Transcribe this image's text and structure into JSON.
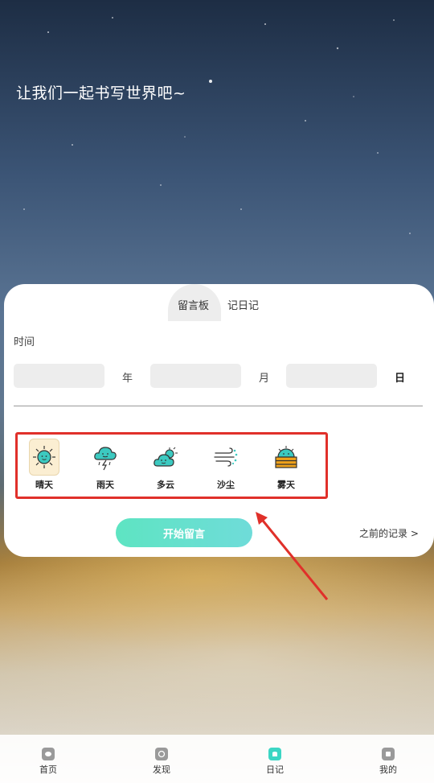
{
  "slogan": "让我们一起书写世界吧~",
  "tabs": [
    {
      "label": "留言板",
      "active": true
    },
    {
      "label": "记日记",
      "active": false
    }
  ],
  "form": {
    "time_label": "时间",
    "year_unit": "年",
    "month_unit": "月",
    "day_unit": "日",
    "year_value": "",
    "month_value": "",
    "day_value": ""
  },
  "weather": [
    {
      "label": "晴天",
      "icon": "sunny-icon",
      "selected": true
    },
    {
      "label": "雨天",
      "icon": "rain-icon",
      "selected": false
    },
    {
      "label": "多云",
      "icon": "cloudy-icon",
      "selected": false
    },
    {
      "label": "沙尘",
      "icon": "sandstorm-icon",
      "selected": false
    },
    {
      "label": "雾天",
      "icon": "fog-icon",
      "selected": false
    }
  ],
  "actions": {
    "start_label": "开始留言",
    "history_label": "之前的记录 >"
  },
  "bottom_nav": [
    {
      "label": "首页",
      "icon": "home-icon",
      "active": false
    },
    {
      "label": "发现",
      "icon": "discover-icon",
      "active": false
    },
    {
      "label": "日记",
      "icon": "diary-icon",
      "active": true
    },
    {
      "label": "我的",
      "icon": "profile-icon",
      "active": false
    }
  ],
  "colors": {
    "accent": "#5ee4c2",
    "selected_bg": "#fbeed2",
    "annotation": "#e0302a",
    "icon_teal": "#3cc9c0",
    "icon_orange": "#f0a21a"
  }
}
